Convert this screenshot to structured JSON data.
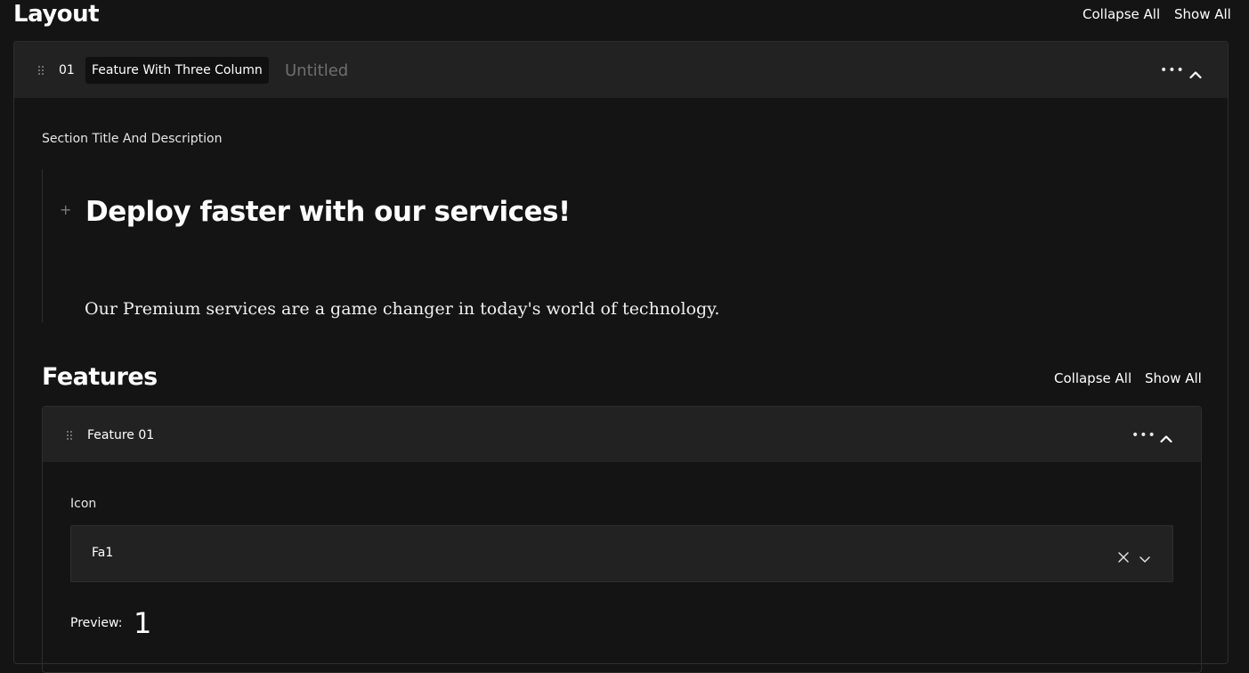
{
  "header": {
    "title": "Layout",
    "collapse_all": "Collapse All",
    "show_all": "Show All"
  },
  "layout_block": {
    "number": "01",
    "block_type": "Feature With Three Column",
    "block_name": "Untitled",
    "more_icon": "more-horizontal-icon",
    "toggle_icon": "chevron-up-icon",
    "drag_icon": "drag-handle-icon"
  },
  "section": {
    "label": "Section Title And Description",
    "heading": "Deploy faster with our services!",
    "description": "Our Premium services are a game changer in today's world of technology.",
    "add_icon": "plus-icon"
  },
  "features": {
    "title": "Features",
    "collapse_all": "Collapse All",
    "show_all": "Show All",
    "items": [
      {
        "name": "Feature 01",
        "icon_label": "Icon",
        "icon_value": "Fa1",
        "preview_label": "Preview:",
        "preview_value": "1"
      }
    ]
  },
  "colors": {
    "background": "#141414",
    "panel": "#222222",
    "border": "#2e2e2e",
    "muted_text": "#6f6f6f"
  }
}
